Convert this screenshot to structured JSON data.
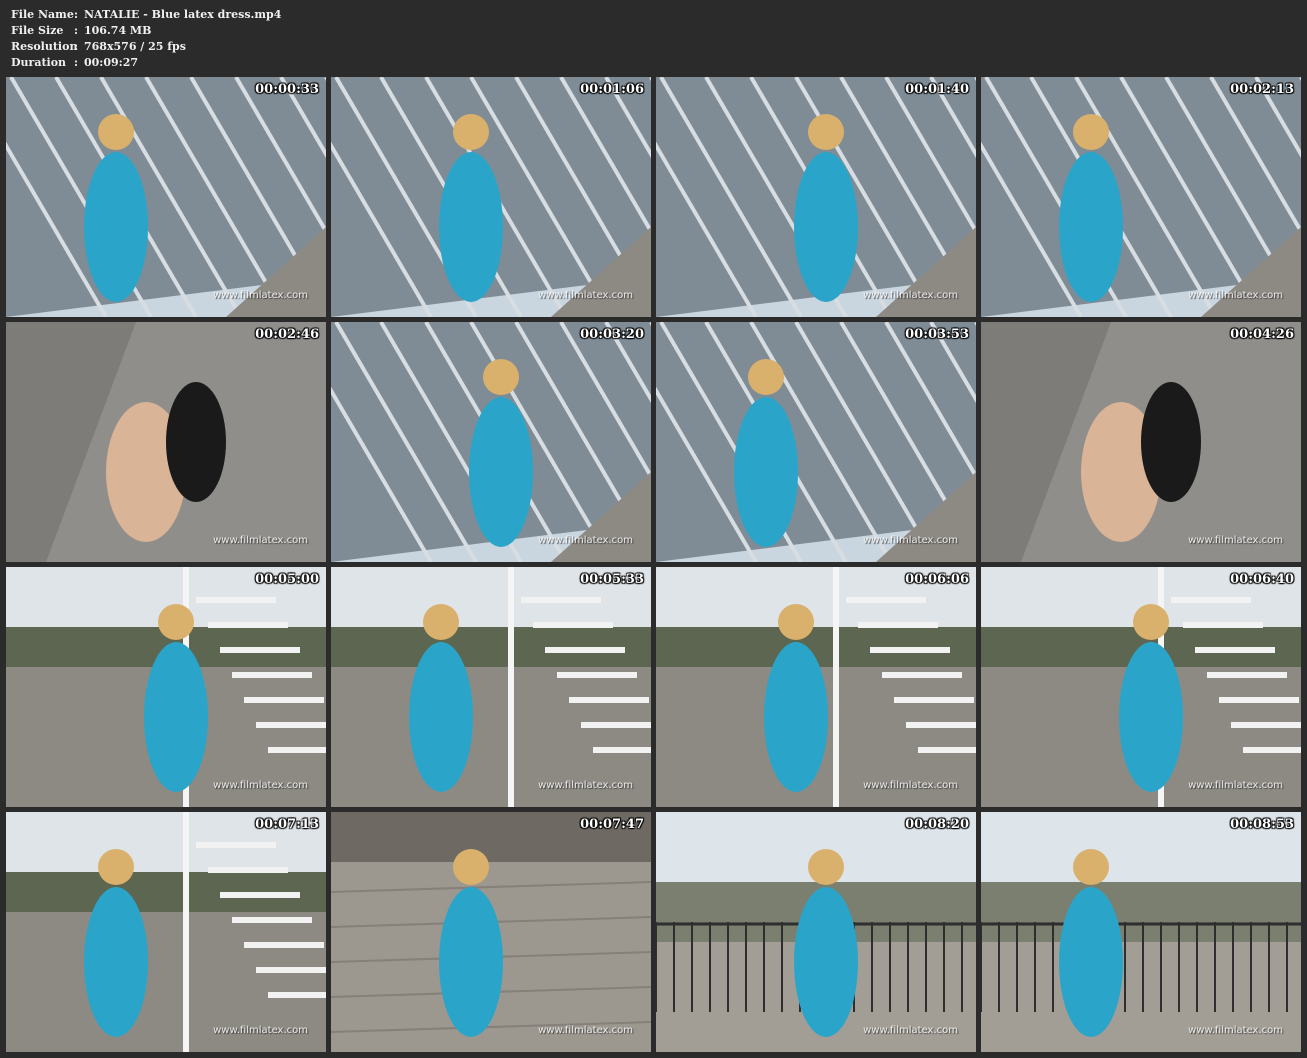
{
  "info": {
    "rows": [
      {
        "label": "File Name",
        "sep": ":",
        "value": "NATALIE - Blue latex dress.mp4"
      },
      {
        "label": "File Size",
        "sep": ":",
        "value": "106.74 MB"
      },
      {
        "label": "Resolution",
        "sep": ":",
        "value": "768x576 / 25 fps"
      },
      {
        "label": "Duration",
        "sep": ":",
        "value": "00:09:27"
      }
    ]
  },
  "watermark": "www.filmlatex.com",
  "thumbnails": [
    {
      "time": "00:00:33",
      "scene": "glass-roof"
    },
    {
      "time": "00:01:06",
      "scene": "glass-roof"
    },
    {
      "time": "00:01:40",
      "scene": "glass-roof"
    },
    {
      "time": "00:02:13",
      "scene": "glass-roof"
    },
    {
      "time": "00:02:46",
      "scene": "shoes-closeup"
    },
    {
      "time": "00:03:20",
      "scene": "glass-roof"
    },
    {
      "time": "00:03:53",
      "scene": "glass-roof"
    },
    {
      "time": "00:04:26",
      "scene": "shoes-closeup"
    },
    {
      "time": "00:05:00",
      "scene": "stairs"
    },
    {
      "time": "00:05:33",
      "scene": "stairs"
    },
    {
      "time": "00:06:06",
      "scene": "stairs"
    },
    {
      "time": "00:06:40",
      "scene": "stairs"
    },
    {
      "time": "00:07:13",
      "scene": "stairs"
    },
    {
      "time": "00:07:47",
      "scene": "rooftop-floor"
    },
    {
      "time": "00:08:20",
      "scene": "railing"
    },
    {
      "time": "00:08:53",
      "scene": "railing"
    }
  ],
  "colors": {
    "background": "#2b2b2b",
    "dress": "#2aa5c9",
    "sky": "#c9d6e0",
    "glass": "#7f8c96",
    "floor": "#8d8a84"
  }
}
